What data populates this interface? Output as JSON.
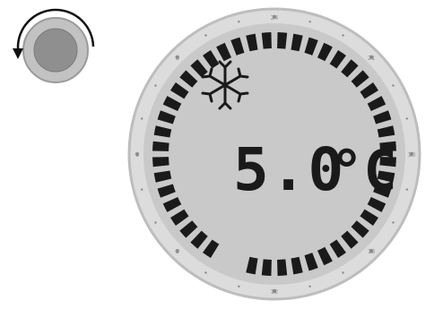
{
  "knob": {
    "icon": "rotary-knob-icon",
    "rotation_icon": "counterclockwise-arrow-icon"
  },
  "display": {
    "mode_icon": "snowflake-icon",
    "temperature": "5.0",
    "unit": "°C",
    "ring_segments_total": 48,
    "ring_segments_lit": 44,
    "dial_marks": [
      "24",
      "21",
      "18",
      "15",
      "12",
      "9",
      "6",
      "3"
    ],
    "colors": {
      "lcd_background": "#c9c9c9",
      "bezel": "#d6d6d6",
      "segment": "#1a1a1a",
      "knob_outer": "#bdbdbd",
      "knob_inner": "#8e8e8e"
    }
  }
}
